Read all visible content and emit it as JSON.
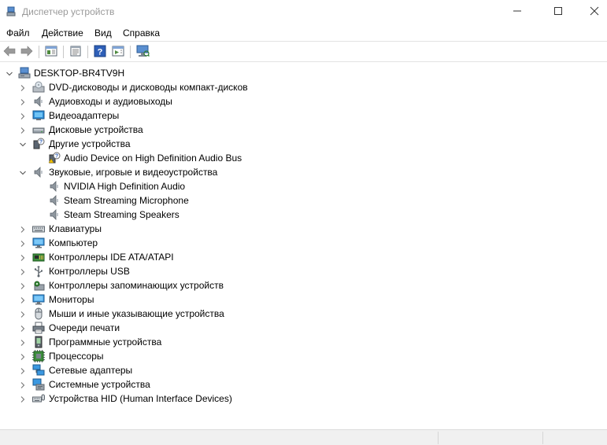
{
  "window": {
    "title": "Диспетчер устройств",
    "icons": {
      "app": "device-manager-icon",
      "minimize": "minimize-icon",
      "maximize": "maximize-icon",
      "close": "close-icon"
    }
  },
  "menu": {
    "items": [
      {
        "label": "Файл"
      },
      {
        "label": "Действие"
      },
      {
        "label": "Вид"
      },
      {
        "label": "Справка"
      }
    ]
  },
  "toolbar": {
    "buttons": [
      {
        "icon": "back-arrow-icon"
      },
      {
        "icon": "forward-arrow-icon"
      },
      {
        "icon": "show-hide-console-tree-icon"
      },
      {
        "icon": "properties-icon"
      },
      {
        "icon": "help-icon"
      },
      {
        "icon": "action-pane-icon"
      },
      {
        "icon": "scan-hardware-icon"
      }
    ]
  },
  "tree": {
    "root": {
      "label": "DESKTOP-BR4TV9H",
      "expanded": true,
      "icon": "computer-icon"
    },
    "items": [
      {
        "label": "DVD-дисководы и дисководы компакт-дисков",
        "level": 1,
        "expander": "collapsed",
        "icon": "dvd-drive-icon"
      },
      {
        "label": "Аудиовходы и аудиовыходы",
        "level": 1,
        "expander": "collapsed",
        "icon": "speaker-icon"
      },
      {
        "label": "Видеоадаптеры",
        "level": 1,
        "expander": "collapsed",
        "icon": "display-adapter-icon"
      },
      {
        "label": "Дисковые устройства",
        "level": 1,
        "expander": "collapsed",
        "icon": "disk-drive-icon"
      },
      {
        "label": "Другие устройства",
        "level": 1,
        "expander": "expanded",
        "icon": "unknown-device-icon"
      },
      {
        "label": "Audio Device on High Definition Audio Bus",
        "level": 2,
        "expander": "none",
        "icon": "unknown-device-warning-icon"
      },
      {
        "label": "Звуковые, игровые и видеоустройства",
        "level": 1,
        "expander": "expanded",
        "icon": "speaker-icon"
      },
      {
        "label": "NVIDIA High Definition Audio",
        "level": 2,
        "expander": "none",
        "icon": "speaker-icon"
      },
      {
        "label": "Steam Streaming Microphone",
        "level": 2,
        "expander": "none",
        "icon": "speaker-icon"
      },
      {
        "label": "Steam Streaming Speakers",
        "level": 2,
        "expander": "none",
        "icon": "speaker-icon"
      },
      {
        "label": "Клавиатуры",
        "level": 1,
        "expander": "collapsed",
        "icon": "keyboard-icon"
      },
      {
        "label": "Компьютер",
        "level": 1,
        "expander": "collapsed",
        "icon": "monitor-icon"
      },
      {
        "label": "Контроллеры IDE ATA/ATAPI",
        "level": 1,
        "expander": "collapsed",
        "icon": "ide-controller-icon"
      },
      {
        "label": "Контроллеры USB",
        "level": 1,
        "expander": "collapsed",
        "icon": "usb-icon"
      },
      {
        "label": "Контроллеры запоминающих устройств",
        "level": 1,
        "expander": "collapsed",
        "icon": "storage-controller-icon"
      },
      {
        "label": "Мониторы",
        "level": 1,
        "expander": "collapsed",
        "icon": "monitor-icon"
      },
      {
        "label": "Мыши и иные указывающие устройства",
        "level": 1,
        "expander": "collapsed",
        "icon": "mouse-icon"
      },
      {
        "label": "Очереди печати",
        "level": 1,
        "expander": "collapsed",
        "icon": "printer-icon"
      },
      {
        "label": "Программные устройства",
        "level": 1,
        "expander": "collapsed",
        "icon": "software-device-icon"
      },
      {
        "label": "Процессоры",
        "level": 1,
        "expander": "collapsed",
        "icon": "processor-icon"
      },
      {
        "label": "Сетевые адаптеры",
        "level": 1,
        "expander": "collapsed",
        "icon": "network-adapter-icon"
      },
      {
        "label": "Системные устройства",
        "level": 1,
        "expander": "collapsed",
        "icon": "system-device-icon"
      },
      {
        "label": "Устройства HID (Human Interface Devices)",
        "level": 1,
        "expander": "collapsed",
        "icon": "hid-icon"
      }
    ]
  }
}
